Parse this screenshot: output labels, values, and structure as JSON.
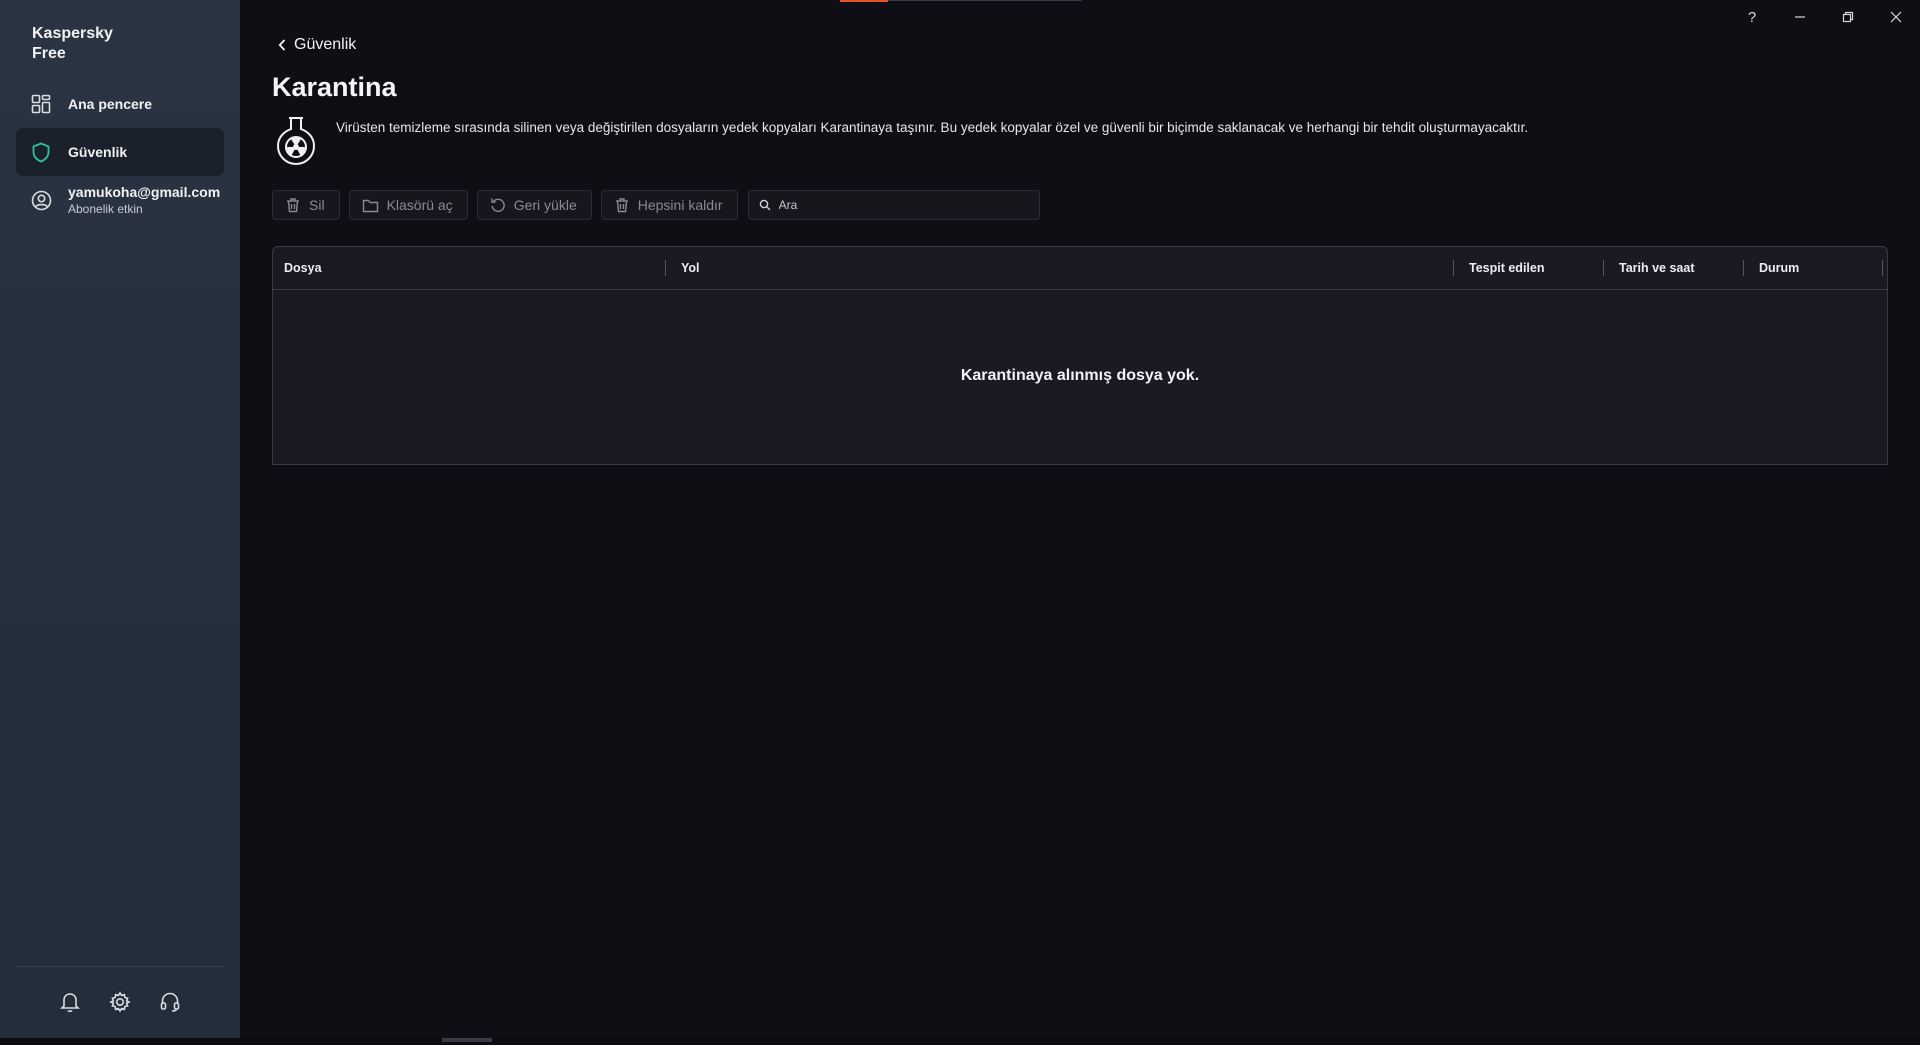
{
  "app": {
    "brand": "Kaspersky\nFree"
  },
  "sidebar": {
    "items": [
      {
        "label": "Ana pencere",
        "icon": "grid-icon"
      },
      {
        "label": "Güvenlik",
        "icon": "shield-icon",
        "active": true
      },
      {
        "label": "yamukoha@gmail.com",
        "sub": "Abonelik etkin",
        "icon": "user-icon"
      }
    ],
    "bottom_icons": [
      "bell-icon",
      "gear-icon",
      "headset-icon"
    ]
  },
  "window": {
    "help": "?"
  },
  "page": {
    "back_label": "Güvenlik",
    "title": "Karantina",
    "description": "Virüsten temizleme sırasında silinen veya değiştirilen dosyaların yedek kopyaları Karantinaya taşınır. Bu yedek kopyalar özel ve güvenli bir biçimde saklanacak ve herhangi bir tehdit oluşturmayacaktır."
  },
  "toolbar": {
    "delete_label": "Sil",
    "open_folder_label": "Klasörü aç",
    "restore_label": "Geri yükle",
    "remove_all_label": "Hepsini kaldır",
    "search_placeholder": "Ara"
  },
  "table": {
    "columns": [
      "Dosya",
      "Yol",
      "Tespit edilen",
      "Tarih ve saat",
      "Durum"
    ],
    "empty_message": "Karantinaya alınmış dosya yok."
  },
  "colors": {
    "accent": "#e8502a",
    "shield": "#2fbf9f",
    "background": "#0e0e14",
    "sidebar": "#26303d"
  }
}
